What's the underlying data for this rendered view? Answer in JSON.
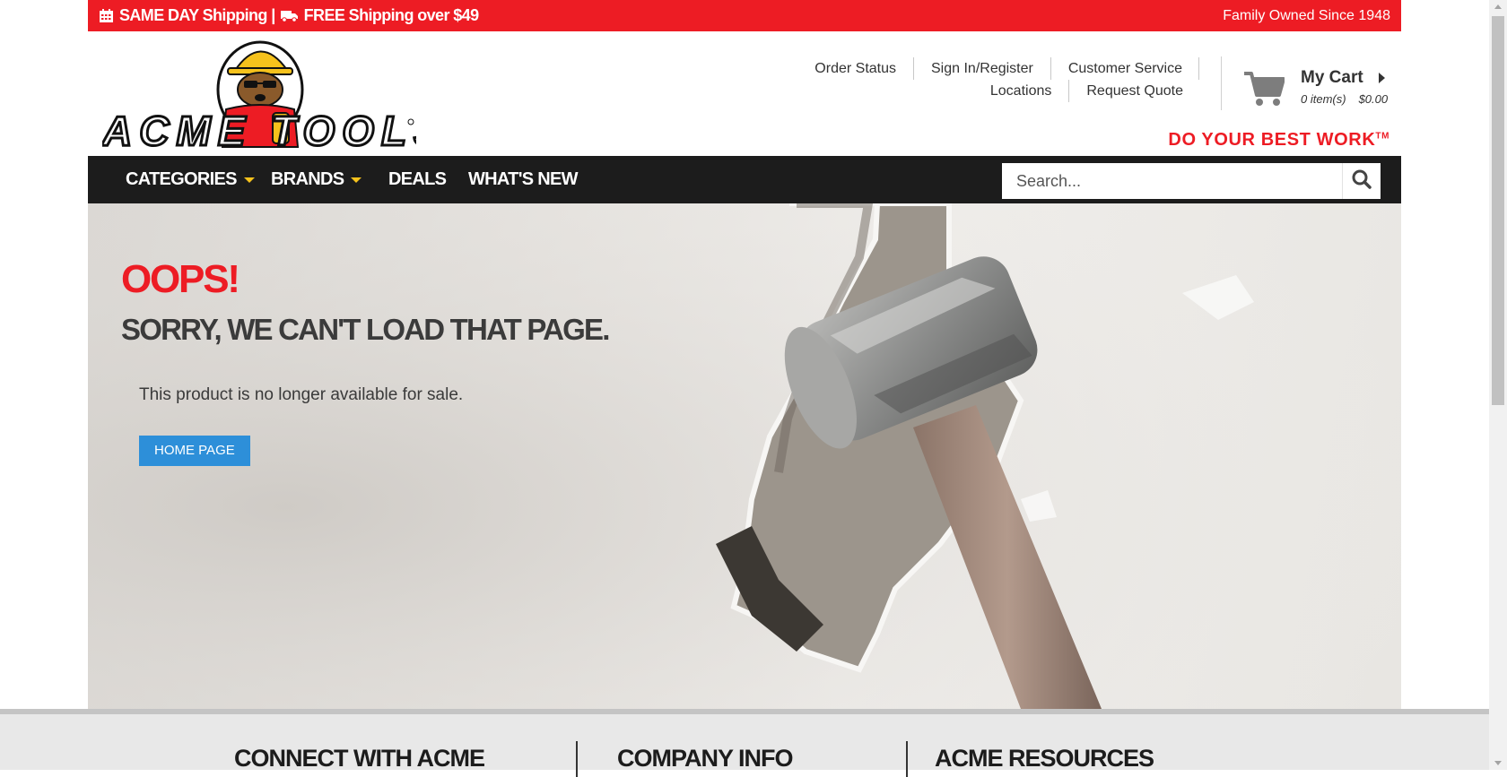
{
  "promo": {
    "shipping_text": "SAME DAY Shipping |",
    "free_shipping_text": "FREE Shipping over $49",
    "family_owned": "Family Owned Since 1948"
  },
  "header": {
    "logo_text": "ACME TOOLS",
    "util_links": [
      "Order Status",
      "Sign In/Register",
      "Customer Service",
      "Locations",
      "Request Quote"
    ],
    "cart": {
      "title": "My Cart",
      "items": "0 item(s)",
      "total": "$0.00"
    },
    "tagline": "DO YOUR BEST WORK",
    "tagline_mark": "TM"
  },
  "nav": {
    "categories": "CATEGORIES",
    "brands": "BRANDS",
    "deals": "DEALS",
    "whats_new": "WHAT'S NEW",
    "search_placeholder": "Search..."
  },
  "hero": {
    "oops": "OOPS!",
    "sorry": "SORRY, WE CAN'T LOAD THAT PAGE.",
    "message": "This product is no longer available for sale.",
    "home_button": "HOME PAGE"
  },
  "footer": {
    "columns": [
      "CONNECT WITH ACME",
      "COMPANY INFO",
      "ACME RESOURCES"
    ]
  },
  "colors": {
    "brand_red": "#ed1c24",
    "nav_dark": "#1c1c1c",
    "accent_yellow": "#f6c21c",
    "button_blue": "#2d8fd9"
  },
  "icons": [
    "calendar-icon",
    "truck-icon",
    "cart-icon",
    "search-icon",
    "chevron-right-icon",
    "caret-down-icon"
  ]
}
